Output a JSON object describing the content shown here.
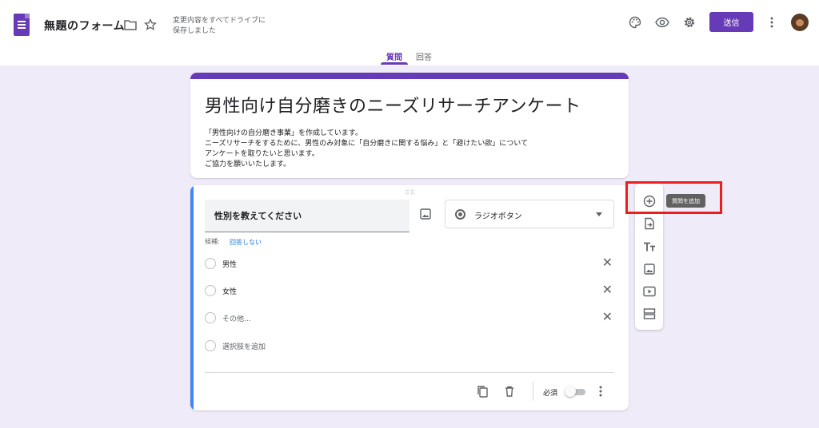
{
  "header": {
    "doc_title": "無題のフォーム",
    "save_status_line1": "変更内容をすべてドライブに",
    "save_status_line2": "保存しました",
    "send_label": "送信",
    "icons": [
      "forms-logo-icon",
      "folder-icon",
      "star-icon",
      "palette-icon",
      "eye-icon",
      "gear-icon",
      "more-vert-icon"
    ]
  },
  "tabs": [
    {
      "label": "質問",
      "active": true
    },
    {
      "label": "回答",
      "active": false
    }
  ],
  "form": {
    "title": "男性向け自分磨きのニーズリサーチアンケート",
    "description": [
      "「男性向けの自分磨き事業」を作成しています。",
      "ニーズリサーチをするために、男性のみ対象に「自分磨きに関する悩み」と「避けたい欲」について",
      "アンケートを取りたいと思います。",
      "ご協力を願いいたします。"
    ]
  },
  "question": {
    "title": "性別を教えてください",
    "type_label": "ラジオボタン",
    "hint_label": "候補:",
    "hint_link": "回答しない",
    "options": [
      "男性",
      "女性",
      "その他..."
    ],
    "add_option_label": "選択肢を追加",
    "required_label": "必須",
    "required": false
  },
  "toolbar": {
    "tooltip": "質問を追加",
    "buttons": [
      "add-question-icon",
      "import-questions-icon",
      "add-title-icon",
      "add-image-icon",
      "add-video-icon",
      "add-section-icon"
    ]
  },
  "colors": {
    "accent": "#673ab7",
    "background": "#f0ebf8",
    "active_card": "#4285f4",
    "highlight": "#ee1c1c"
  }
}
